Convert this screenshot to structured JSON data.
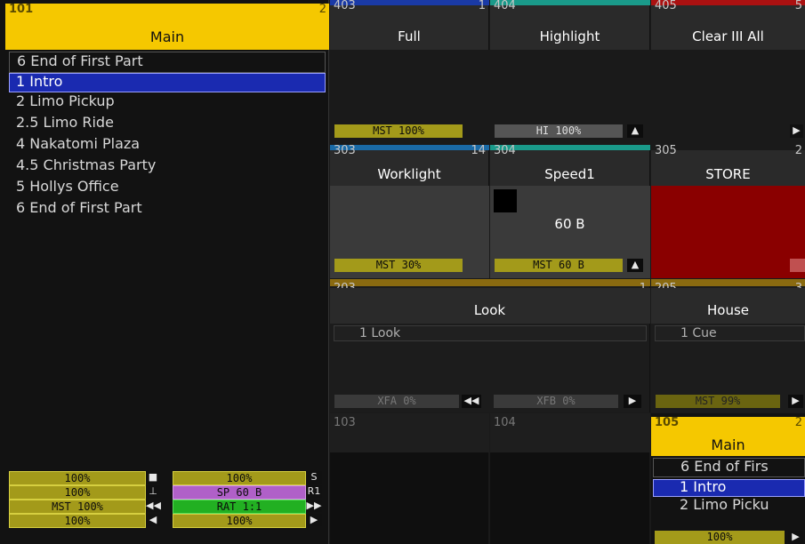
{
  "main_exec": {
    "number": "101",
    "page": "2",
    "title": "Main",
    "header_row": "6 End of First Part",
    "cues": [
      "1 Intro",
      "2 Limo Pickup",
      "2.5 Limo Ride",
      "4 Nakatomi Plaza",
      "4.5 Christmas Party",
      "5 Hollys Office",
      "6 End of First Part"
    ],
    "controls": {
      "left": [
        "100%",
        "100%",
        "MST 100%",
        "100%"
      ],
      "right": [
        "100%",
        "SP 60 B",
        "RAT 1:1",
        "100%"
      ],
      "mid_icons": [
        "■",
        "⊥",
        "◀◀",
        "◀"
      ],
      "right_icons": [
        "S",
        "R1",
        "▶▶",
        "▶"
      ]
    }
  },
  "executors": {
    "e403": {
      "number": "403",
      "page": "1",
      "title": "Full",
      "bar": "MST 100%",
      "color": "#1a3aa6"
    },
    "e404": {
      "number": "404",
      "page": "",
      "title": "Highlight",
      "bar": "HI 100%",
      "color": "#1a9a8a"
    },
    "e405": {
      "number": "405",
      "page": "5",
      "title": "Clear III All",
      "color": "#aa1111"
    },
    "e303": {
      "number": "303",
      "page": "14",
      "title": "Worklight",
      "bar": "MST 30%",
      "color": "#1a6aa6"
    },
    "e304": {
      "number": "304",
      "page": "",
      "title": "Speed1",
      "value": "60 B",
      "bar": "MST 60 B",
      "color": "#1a9a8a"
    },
    "e305": {
      "number": "305",
      "page": "2",
      "title": "STORE",
      "color": "#8a0000"
    },
    "e203": {
      "number": "203",
      "page": "1",
      "title": "Look",
      "cue": "1 Look",
      "bar_a": "XFA 0%",
      "bar_b": "XFB 0%"
    },
    "e205": {
      "number": "205",
      "page": "3",
      "title": "House",
      "cue": "1 Cue",
      "bar": "MST 99%"
    },
    "e103": {
      "number": "103"
    },
    "e104": {
      "number": "104"
    },
    "e105": {
      "number": "105",
      "page": "2",
      "title": "Main",
      "header_row": "6 End of Firs",
      "cues": [
        "1 Intro",
        "2 Limo Picku"
      ],
      "bar": "100%"
    }
  },
  "colors": {
    "accent_yellow": "#f5c800",
    "selection_blue": "#1a2ab0",
    "fader_olive": "#a39a1a",
    "speed_purple": "#b060c8",
    "rate_green": "#22b022",
    "store_red": "#8a0000",
    "bronze_strip": "#8a6a10"
  }
}
